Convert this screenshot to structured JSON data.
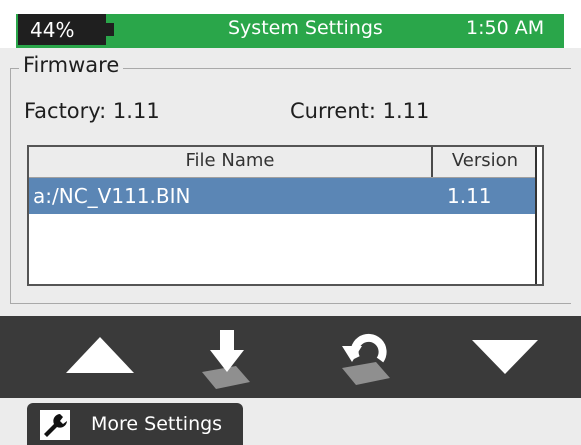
{
  "status_bar": {
    "battery_percent_label": "44%",
    "battery_level": 0.44,
    "title": "System Settings",
    "time": "1:50 AM",
    "accent_color": "#2aa64a"
  },
  "firmware": {
    "group_label": "Firmware",
    "factory_text": "Factory: 1.11",
    "current_text": "Current: 1.11",
    "table": {
      "columns": [
        "File Name",
        "Version"
      ],
      "rows": [
        {
          "file": "a:/NC_V111.BIN",
          "version": "1.11",
          "selected": true
        }
      ],
      "selection_color": "#5b86b5"
    }
  },
  "toolbar": {
    "buttons": [
      {
        "name": "up-arrow-icon"
      },
      {
        "name": "install-download-icon"
      },
      {
        "name": "restore-icon"
      },
      {
        "name": "down-arrow-icon"
      }
    ]
  },
  "bottom_tab": {
    "label": "More Settings",
    "icon": "wrench-icon"
  }
}
